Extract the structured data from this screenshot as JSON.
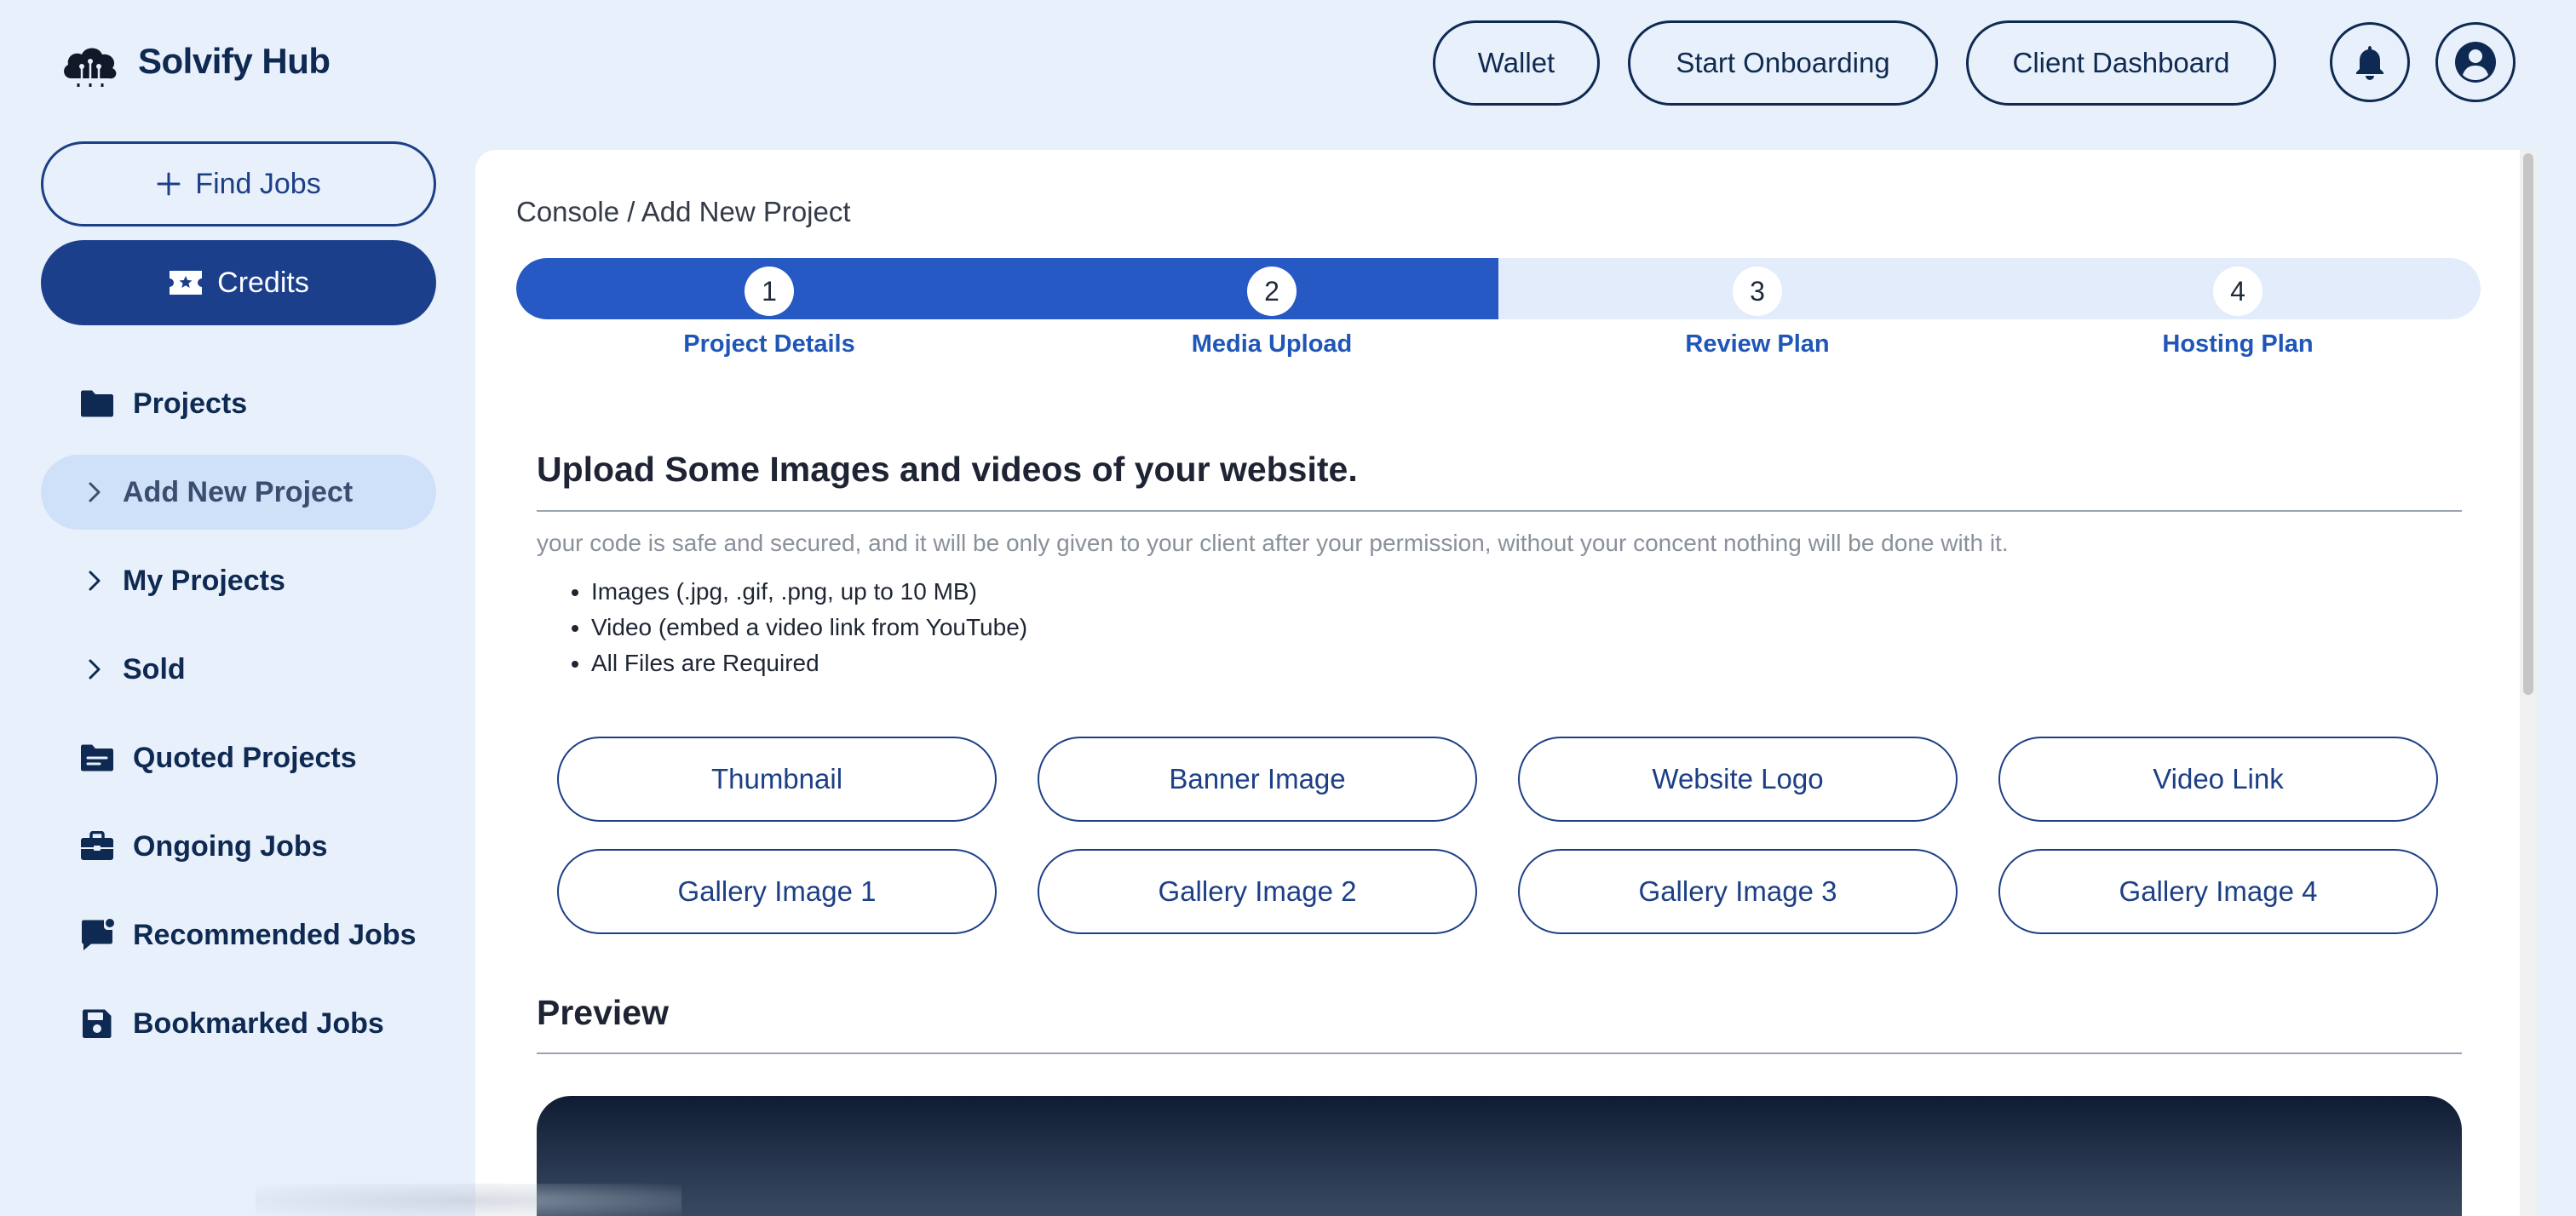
{
  "brand": {
    "name": "Solvify Hub"
  },
  "header": {
    "wallet": "Wallet",
    "onboarding": "Start Onboarding",
    "client_dashboard": "Client Dashboard"
  },
  "sidebar": {
    "find_jobs": "Find Jobs",
    "credits": "Credits",
    "items": [
      {
        "label": "Projects",
        "icon": "folder-icon"
      },
      {
        "label": "Add New Project",
        "icon": "chevron-right-icon"
      },
      {
        "label": "My Projects",
        "icon": "chevron-right-icon"
      },
      {
        "label": "Sold",
        "icon": "chevron-right-icon"
      },
      {
        "label": "Quoted Projects",
        "icon": "inbox-icon"
      },
      {
        "label": "Ongoing Jobs",
        "icon": "briefcase-icon"
      },
      {
        "label": "Recommended Jobs",
        "icon": "message-icon"
      },
      {
        "label": "Bookmarked Jobs",
        "icon": "floppy-icon"
      }
    ]
  },
  "main": {
    "breadcrumb": "Console / Add New Project",
    "steps": [
      {
        "num": "1",
        "label": "Project Details"
      },
      {
        "num": "2",
        "label": "Media Upload"
      },
      {
        "num": "3",
        "label": "Review Plan"
      },
      {
        "num": "4",
        "label": "Hosting Plan"
      }
    ],
    "steps_completed": 2,
    "upload_title": "Upload Some Images and videos of your website.",
    "note": "your code is safe and secured, and it will be only given to your client after your permission, without your concent nothing will be done with it.",
    "requirements": [
      "Images (.jpg, .gif, .png, up to 10 MB)",
      "Video (embed a video link from YouTube)",
      "All Files are Required"
    ],
    "uploads": [
      "Thumbnail",
      "Banner Image",
      "Website Logo",
      "Video Link",
      "Gallery Image 1",
      "Gallery Image 2",
      "Gallery Image 3",
      "Gallery Image 4"
    ],
    "preview_title": "Preview"
  },
  "colors": {
    "background": "#e8f0fb",
    "accent": "#2659c4",
    "navy": "#0f2a52",
    "credits_bg": "#1c3f8c"
  }
}
